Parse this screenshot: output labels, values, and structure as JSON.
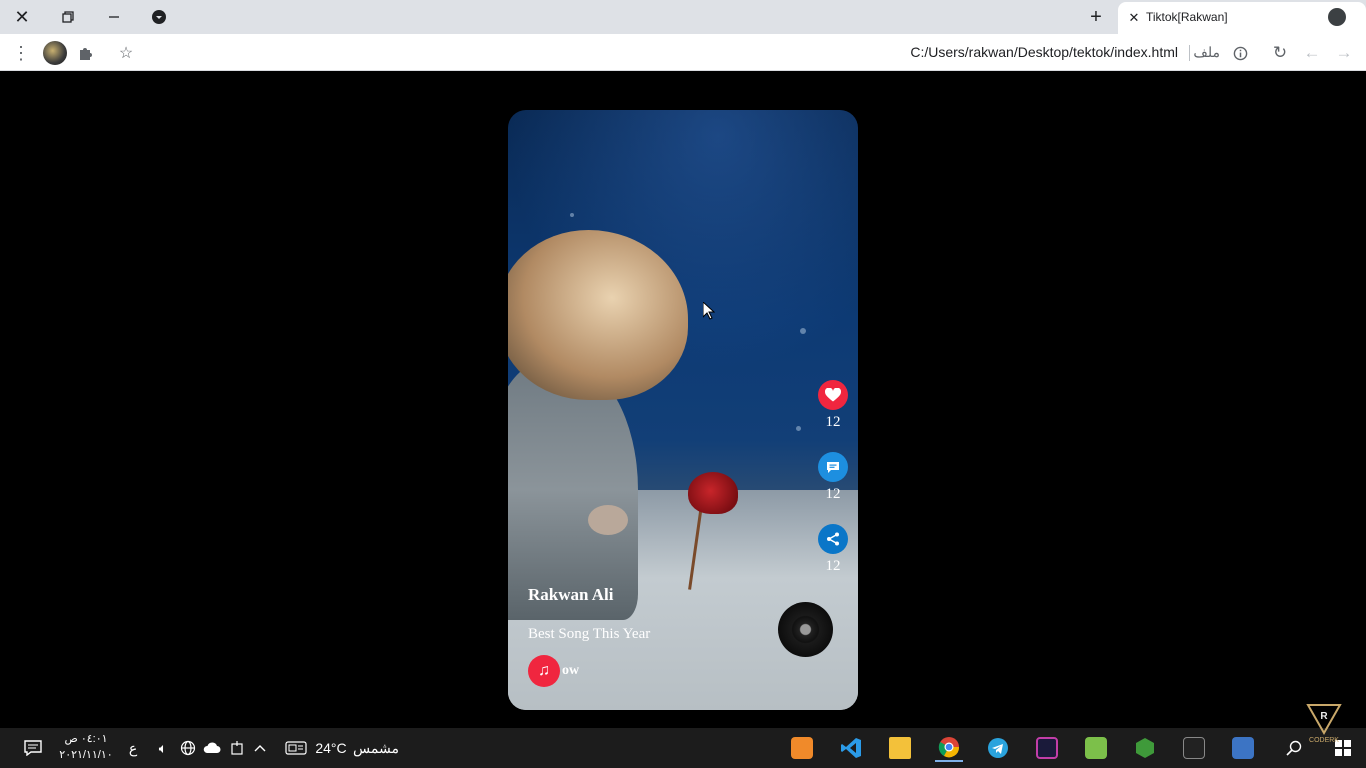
{
  "browser": {
    "tab_title": "Tiktok[Rakwan]",
    "address": "C:/Users/rakwan/Desktop/tektok/index.html",
    "scheme_label": "ملف"
  },
  "post": {
    "username": "Rakwan Ali",
    "description": "Best Song This Year",
    "music_text": "ow",
    "likes": "12",
    "comments": "12",
    "shares": "12"
  },
  "taskbar": {
    "time": "٠٤:٠١ ص",
    "date": "٢٠٢١/١١/١٠",
    "lang": "ع",
    "weather_temp": "24°C",
    "weather_text": "مشمس"
  },
  "watermark": {
    "text": "CODERK"
  },
  "colors": {
    "like": "#f0263f",
    "comment": "#1d8fe0",
    "share": "#0a76c8",
    "tabbar": "#dee1e6"
  },
  "icons": [
    "close-icon",
    "restore-icon",
    "minimize-icon",
    "tab-search-icon",
    "new-tab-icon",
    "menu-icon",
    "extensions-icon",
    "bookmark-star-icon",
    "info-icon",
    "reload-icon",
    "back-icon",
    "forward-icon",
    "heart-icon",
    "comment-icon",
    "share-icon",
    "music-note-icon",
    "notification-icon",
    "volume-icon",
    "network-icon",
    "onedrive-icon",
    "chevron-up-icon",
    "search-icon",
    "windows-icon"
  ]
}
